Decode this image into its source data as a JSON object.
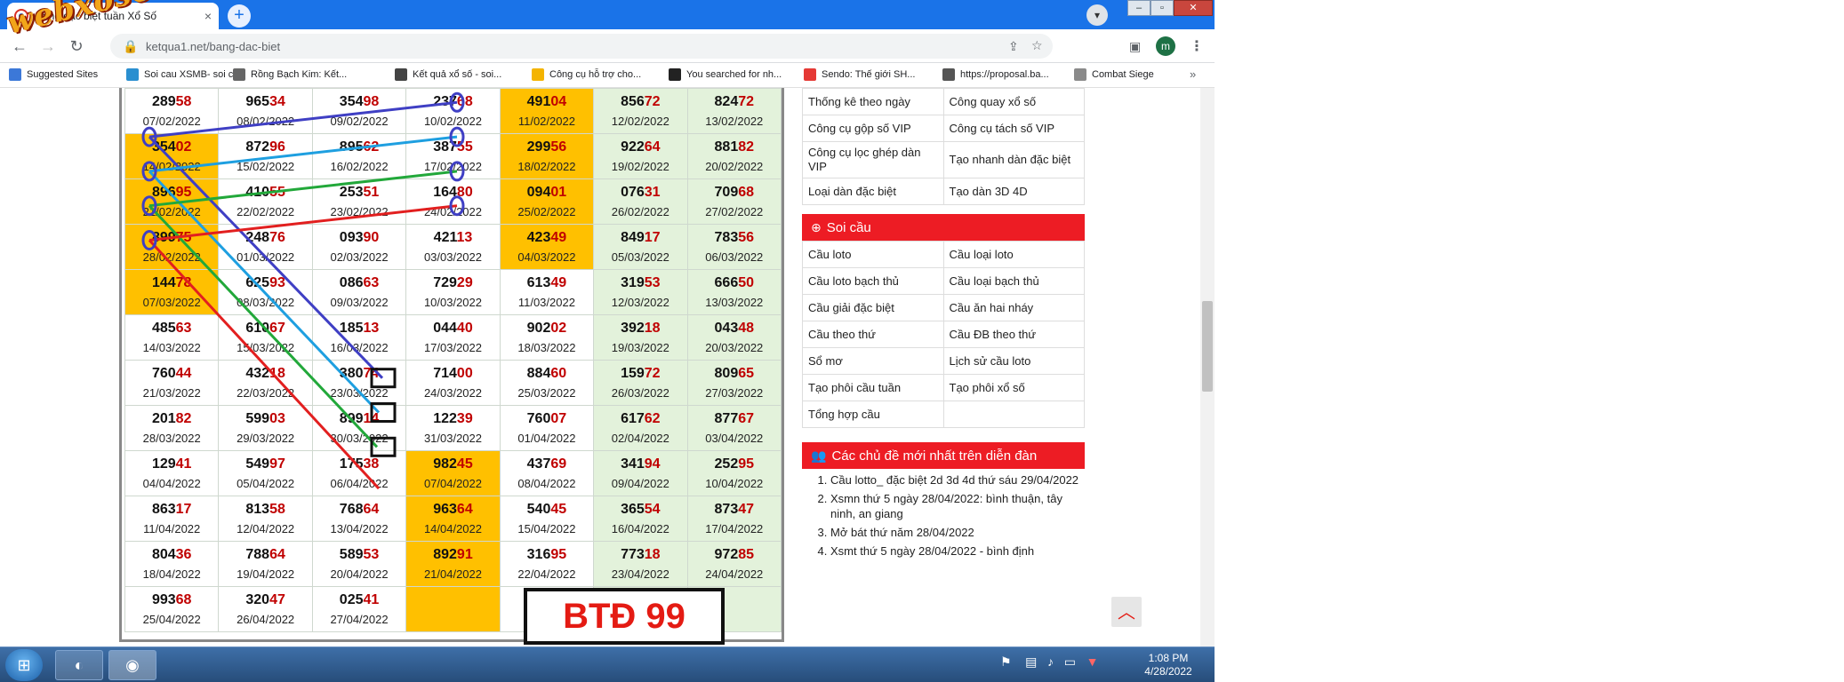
{
  "watermark": "webxoso.net",
  "browser": {
    "tab_title": "Bảng đặc biệt tuần Xổ Số",
    "tab_close": "×",
    "new_tab": "+",
    "url": "ketqua1.net/bang-dac-biet",
    "profile_initial": "m",
    "bookmarks": [
      {
        "label": "Suggested Sites",
        "color": "#3c78d8"
      },
      {
        "label": "Soi cau XSMB- soi c...",
        "color": "#2a8fd0"
      },
      {
        "label": "Rồng Bạch Kim: Kết...",
        "color": "#666666"
      },
      {
        "label": "Kết quả xổ số - soi...",
        "color": "#444444"
      },
      {
        "label": "Công cụ hỗ trợ cho...",
        "color": "#f4b400"
      },
      {
        "label": "You searched for nh...",
        "color": "#222222"
      },
      {
        "label": "Sendo: Thế giới SH...",
        "color": "#e53935"
      },
      {
        "label": "https://proposal.ba...",
        "color": "#555555"
      },
      {
        "label": "Combat Siege",
        "color": "#8a8a8a"
      }
    ],
    "bookmarks_more": "»"
  },
  "results": {
    "rows": [
      [
        {
          "n": "28958",
          "d": "07/02/2022"
        },
        {
          "n": "96534",
          "d": "08/02/2022"
        },
        {
          "n": "35498",
          "d": "09/02/2022"
        },
        {
          "n": "23768",
          "d": "10/02/2022"
        },
        {
          "n": "49104",
          "d": "11/02/2022",
          "hl": true
        },
        {
          "n": "85672",
          "d": "12/02/2022"
        },
        {
          "n": "82472",
          "d": "13/02/2022"
        }
      ],
      [
        {
          "n": "35402",
          "d": "14/02/2022",
          "hl": true
        },
        {
          "n": "87296",
          "d": "15/02/2022"
        },
        {
          "n": "89562",
          "d": "16/02/2022"
        },
        {
          "n": "38755",
          "d": "17/02/2022"
        },
        {
          "n": "29956",
          "d": "18/02/2022",
          "hl": true
        },
        {
          "n": "92264",
          "d": "19/02/2022"
        },
        {
          "n": "88182",
          "d": "20/02/2022"
        }
      ],
      [
        {
          "n": "89695",
          "d": "21/02/2022",
          "hl": true
        },
        {
          "n": "41055",
          "d": "22/02/2022"
        },
        {
          "n": "25351",
          "d": "23/02/2022"
        },
        {
          "n": "16480",
          "d": "24/02/2022"
        },
        {
          "n": "09401",
          "d": "25/02/2022",
          "hl": true
        },
        {
          "n": "07631",
          "d": "26/02/2022"
        },
        {
          "n": "70968",
          "d": "27/02/2022"
        }
      ],
      [
        {
          "n": "89975",
          "d": "28/02/2022",
          "hl": true
        },
        {
          "n": "24876",
          "d": "01/03/2022"
        },
        {
          "n": "09390",
          "d": "02/03/2022"
        },
        {
          "n": "42113",
          "d": "03/03/2022"
        },
        {
          "n": "42349",
          "d": "04/03/2022",
          "hl": true
        },
        {
          "n": "84917",
          "d": "05/03/2022"
        },
        {
          "n": "78356",
          "d": "06/03/2022"
        }
      ],
      [
        {
          "n": "14478",
          "d": "07/03/2022",
          "hl": true
        },
        {
          "n": "62593",
          "d": "08/03/2022"
        },
        {
          "n": "08663",
          "d": "09/03/2022"
        },
        {
          "n": "72929",
          "d": "10/03/2022"
        },
        {
          "n": "61349",
          "d": "11/03/2022"
        },
        {
          "n": "31953",
          "d": "12/03/2022"
        },
        {
          "n": "66650",
          "d": "13/03/2022"
        }
      ],
      [
        {
          "n": "48563",
          "d": "14/03/2022"
        },
        {
          "n": "61067",
          "d": "15/03/2022"
        },
        {
          "n": "18513",
          "d": "16/03/2022"
        },
        {
          "n": "04440",
          "d": "17/03/2022"
        },
        {
          "n": "90202",
          "d": "18/03/2022"
        },
        {
          "n": "39218",
          "d": "19/03/2022"
        },
        {
          "n": "04348",
          "d": "20/03/2022"
        }
      ],
      [
        {
          "n": "76044",
          "d": "21/03/2022"
        },
        {
          "n": "43218",
          "d": "22/03/2022"
        },
        {
          "n": "38074",
          "d": "23/03/2022"
        },
        {
          "n": "71400",
          "d": "24/03/2022"
        },
        {
          "n": "88460",
          "d": "25/03/2022"
        },
        {
          "n": "15972",
          "d": "26/03/2022"
        },
        {
          "n": "80965",
          "d": "27/03/2022"
        }
      ],
      [
        {
          "n": "20182",
          "d": "28/03/2022"
        },
        {
          "n": "59903",
          "d": "29/03/2022"
        },
        {
          "n": "89914",
          "d": "30/03/2022"
        },
        {
          "n": "12239",
          "d": "31/03/2022"
        },
        {
          "n": "76007",
          "d": "01/04/2022"
        },
        {
          "n": "61762",
          "d": "02/04/2022"
        },
        {
          "n": "87767",
          "d": "03/04/2022"
        }
      ],
      [
        {
          "n": "12941",
          "d": "04/04/2022"
        },
        {
          "n": "54997",
          "d": "05/04/2022"
        },
        {
          "n": "17538",
          "d": "06/04/2022"
        },
        {
          "n": "98245",
          "d": "07/04/2022",
          "hl": true
        },
        {
          "n": "43769",
          "d": "08/04/2022"
        },
        {
          "n": "34194",
          "d": "09/04/2022"
        },
        {
          "n": "25295",
          "d": "10/04/2022"
        }
      ],
      [
        {
          "n": "86317",
          "d": "11/04/2022"
        },
        {
          "n": "81358",
          "d": "12/04/2022"
        },
        {
          "n": "76864",
          "d": "13/04/2022"
        },
        {
          "n": "96364",
          "d": "14/04/2022",
          "hl": true
        },
        {
          "n": "54045",
          "d": "15/04/2022"
        },
        {
          "n": "36554",
          "d": "16/04/2022"
        },
        {
          "n": "87347",
          "d": "17/04/2022"
        }
      ],
      [
        {
          "n": "80436",
          "d": "18/04/2022"
        },
        {
          "n": "78864",
          "d": "19/04/2022"
        },
        {
          "n": "58953",
          "d": "20/04/2022"
        },
        {
          "n": "89291",
          "d": "21/04/2022",
          "hl": true
        },
        {
          "n": "31695",
          "d": "22/04/2022"
        },
        {
          "n": "77318",
          "d": "23/04/2022"
        },
        {
          "n": "97285",
          "d": "24/04/2022"
        }
      ],
      [
        {
          "n": "99368",
          "d": "25/04/2022"
        },
        {
          "n": "32047",
          "d": "26/04/2022"
        },
        {
          "n": "02541",
          "d": "27/04/2022"
        },
        {
          "n": "",
          "d": "",
          "hl": true
        },
        {
          "n": "",
          "d": ""
        },
        {
          "n": "",
          "d": ""
        },
        {
          "n": "",
          "d": ""
        }
      ]
    ],
    "weekend_cols": [
      5,
      6
    ],
    "annotation_text": "BTĐ 99",
    "annotation_colors": [
      "#3f3fc4",
      "#1e9fe0",
      "#22a83a",
      "#e21f1f"
    ]
  },
  "sidebar": {
    "tools": [
      [
        "Thống kê theo ngày",
        "Công quay xổ số"
      ],
      [
        "Công cụ gộp số VIP",
        "Công cụ tách số VIP"
      ],
      [
        "Công cụ lọc ghép dàn VIP",
        "Tạo nhanh dàn đặc biệt"
      ],
      [
        "Loại dàn đặc biệt",
        "Tạo dàn 3D 4D"
      ]
    ],
    "soicau_title": "Soi cầu",
    "soicau": [
      [
        "Cầu loto",
        "Cầu loại loto"
      ],
      [
        "Cầu loto bạch thủ",
        "Cầu loại bạch thủ"
      ],
      [
        "Cầu giải đặc biệt",
        "Cầu ăn hai nháy"
      ],
      [
        "Cầu theo thứ",
        "Cầu ĐB theo thứ"
      ],
      [
        "Sổ mơ",
        "Lịch sử cầu loto"
      ],
      [
        "Tạo phôi cầu tuần",
        "Tạo phôi xổ số"
      ],
      [
        "Tổng hợp cầu",
        ""
      ]
    ],
    "forum_title": "Các chủ đề mới nhất trên diễn đàn",
    "forum": [
      "Cầu lotto_ đặc biệt 2d 3d 4d thứ sáu 29/04/2022",
      "Xsmn thứ 5 ngày 28/04/2022: bình thuận, tây ninh, an giang",
      "Mở bát thứ năm 28/04/2022",
      "Xsmt thứ 5 ngày 28/04/2022 - bình định"
    ]
  },
  "taskbar": {
    "time": "1:08 PM",
    "date": "4/28/2022"
  }
}
